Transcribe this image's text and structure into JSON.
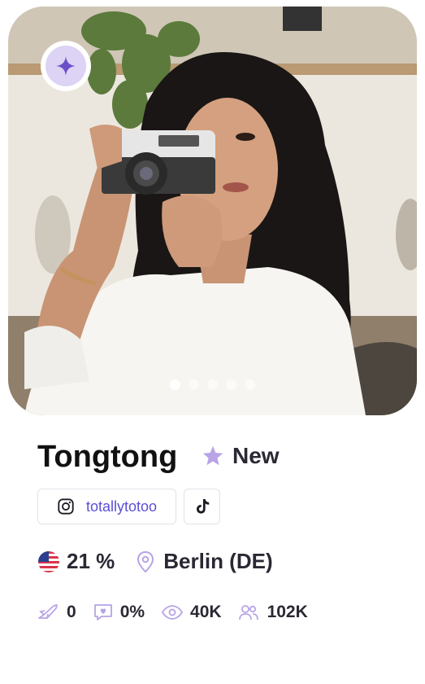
{
  "profile": {
    "name": "Tongtong",
    "tag": "New",
    "instagram_handle": "totallytotoo",
    "country_percent": "21 %",
    "location": "Berlin (DE)"
  },
  "stats": {
    "boosts": "0",
    "response_rate": "0%",
    "views": "40K",
    "followers": "102K"
  },
  "carousel": {
    "total": 5,
    "active_index": 0
  },
  "colors": {
    "accent": "#b8a4e6",
    "badge_bg": "#dcd3f5",
    "link": "#5b4fd6"
  },
  "icons": {
    "badge": "sparkle-icon",
    "tag": "star-icon",
    "instagram": "instagram-icon",
    "tiktok": "tiktok-icon",
    "flag": "us-flag-icon",
    "location": "location-pin-icon",
    "boosts": "rocket-icon",
    "response": "chat-heart-icon",
    "views": "eye-icon",
    "followers": "users-icon"
  }
}
